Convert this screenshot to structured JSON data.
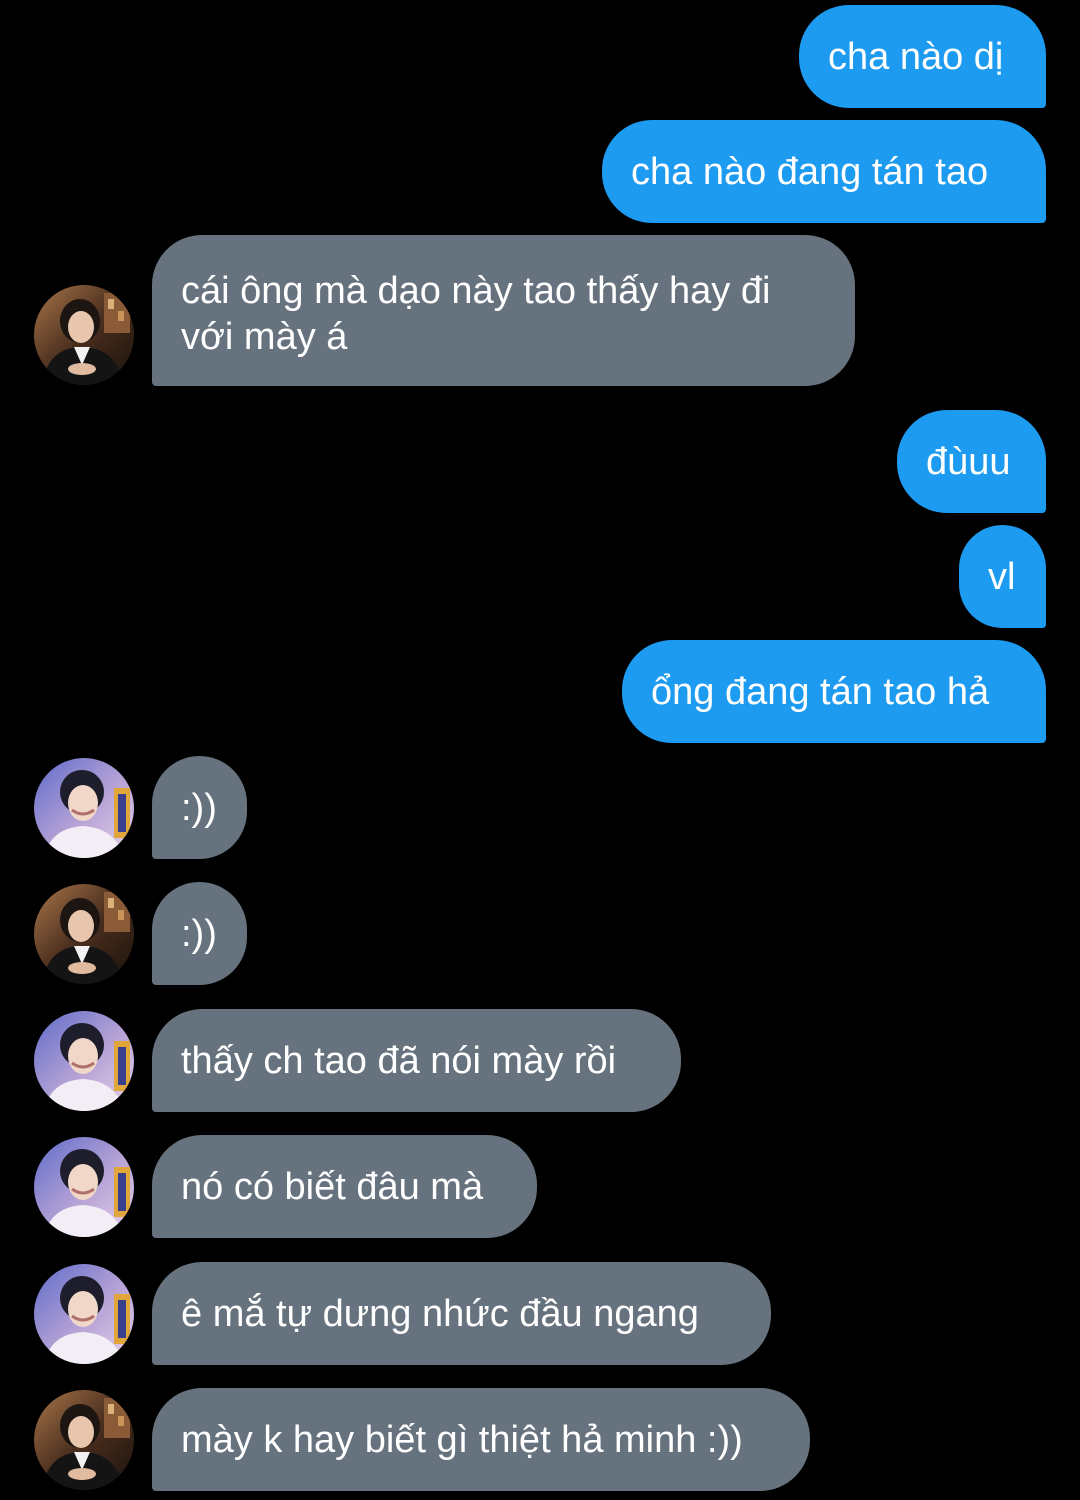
{
  "colors": {
    "background": "#000000",
    "outgoing_bubble": "#1d9bf0",
    "incoming_bubble": "#66737f",
    "text": "#ffffff"
  },
  "messages": [
    {
      "direction": "outgoing",
      "text": "cha nào dị"
    },
    {
      "direction": "outgoing",
      "text": "cha nào đang tán tao"
    },
    {
      "direction": "incoming",
      "avatar": "dark-avatar",
      "text": "cái ông mà dạo này tao thấy hay đi với mày á"
    },
    {
      "direction": "outgoing",
      "text": "đùuu"
    },
    {
      "direction": "outgoing",
      "text": "vl"
    },
    {
      "direction": "outgoing",
      "text": "ổng đang tán tao hả"
    },
    {
      "direction": "incoming",
      "avatar": "light-avatar",
      "text": ":))"
    },
    {
      "direction": "incoming",
      "avatar": "dark-avatar",
      "text": ":))"
    },
    {
      "direction": "incoming",
      "avatar": "light-avatar",
      "text": "thấy ch tao đã nói mày rồi"
    },
    {
      "direction": "incoming",
      "avatar": "light-avatar",
      "text": "nó có biết đâu mà"
    },
    {
      "direction": "incoming",
      "avatar": "light-avatar",
      "text": "ê mắ tự dưng nhức đầu ngang"
    },
    {
      "direction": "incoming",
      "avatar": "dark-avatar",
      "text": "mày k hay biết gì thiệt hả minh :))"
    }
  ]
}
